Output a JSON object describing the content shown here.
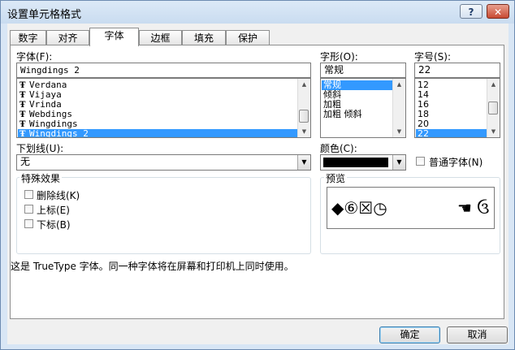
{
  "window": {
    "title": "设置单元格格式",
    "help_label": "?",
    "close_label": "✕"
  },
  "tabs": [
    {
      "label": "数字"
    },
    {
      "label": "对齐"
    },
    {
      "label": "字体"
    },
    {
      "label": "边框"
    },
    {
      "label": "填充"
    },
    {
      "label": "保护"
    }
  ],
  "active_tab": "字体",
  "font": {
    "label": "字体(F):",
    "value": "Wingdings 2",
    "items": [
      {
        "label": "Verdana"
      },
      {
        "label": "Vijaya"
      },
      {
        "label": "Vrinda"
      },
      {
        "label": "Webdings"
      },
      {
        "label": "Wingdings"
      },
      {
        "label": "Wingdings 2",
        "selected": true
      }
    ]
  },
  "style": {
    "label": "字形(O):",
    "value": "常规",
    "items": [
      {
        "label": "常规",
        "selected": true
      },
      {
        "label": "倾斜"
      },
      {
        "label": "加粗"
      },
      {
        "label": "加粗 倾斜"
      }
    ]
  },
  "size": {
    "label": "字号(S):",
    "value": "22",
    "items": [
      {
        "label": "12"
      },
      {
        "label": "14"
      },
      {
        "label": "16"
      },
      {
        "label": "18"
      },
      {
        "label": "20"
      },
      {
        "label": "22",
        "selected": true
      }
    ]
  },
  "underline": {
    "label": "下划线(U):",
    "value": "无"
  },
  "color": {
    "label": "颜色(C):",
    "swatch": "#000000"
  },
  "normal_font": {
    "label": "普通字体(N)",
    "checked": false
  },
  "effects": {
    "label": "特殊效果",
    "strikethrough": {
      "label": "删除线(K)",
      "checked": false
    },
    "superscript": {
      "label": "上标(E)",
      "checked": false
    },
    "subscript": {
      "label": "下标(B)",
      "checked": false
    }
  },
  "preview": {
    "label": "预览",
    "left_glyphs": "◆⑥☒◷",
    "right_glyphs": "☚ ઉ"
  },
  "info_text": "这是 TrueType 字体。同一种字体将在屏幕和打印机上同时使用。",
  "buttons": {
    "ok": "确定",
    "cancel": "取消"
  },
  "colors": {
    "selection": "#3399ff",
    "title_bg": "#d8e6f5",
    "close": "#c84a31"
  }
}
